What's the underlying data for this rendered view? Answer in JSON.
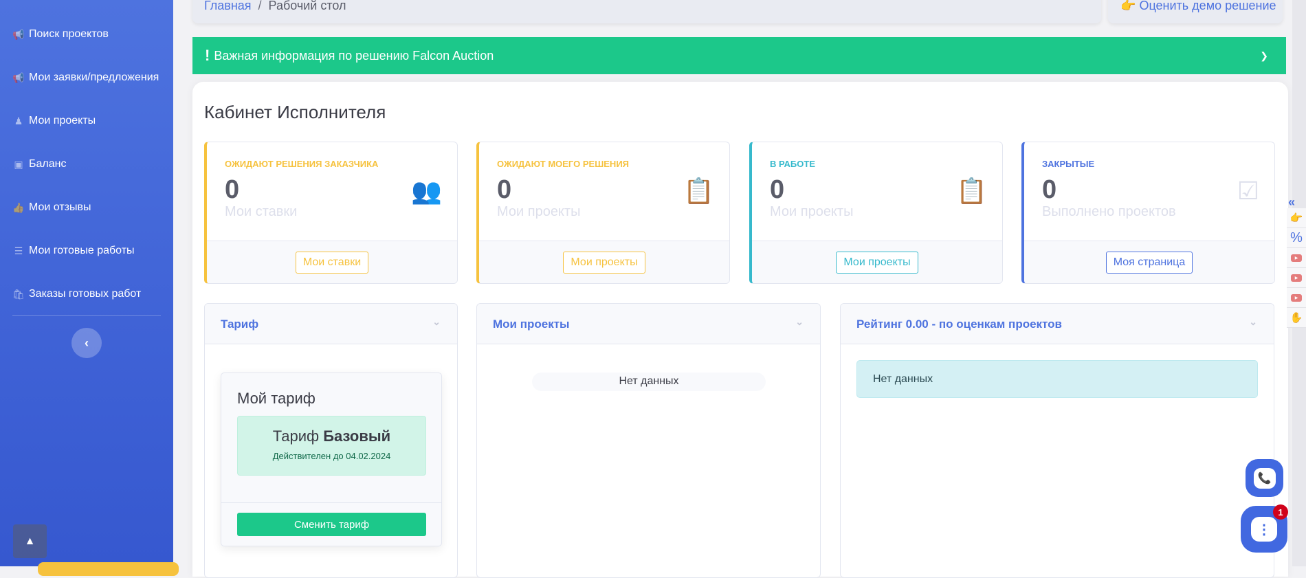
{
  "sidebar": {
    "items": [
      {
        "label": "Поиск проектов",
        "icon": "megaphone-icon"
      },
      {
        "label": "Мои заявки/предложения",
        "icon": "megaphone-icon"
      },
      {
        "label": "Мои проекты",
        "icon": "users-icon"
      },
      {
        "label": "Баланс",
        "icon": "money-icon"
      },
      {
        "label": "Мои отзывы",
        "icon": "thumbs-up-icon"
      },
      {
        "label": "Мои готовые работы",
        "icon": "list-icon"
      },
      {
        "label": "Заказы готовых работ",
        "icon": "bag-icon"
      }
    ]
  },
  "breadcrumb": {
    "home": "Главная",
    "separator": "/",
    "current": "Рабочий стол"
  },
  "rate_button": "Оценить демо решение",
  "alert": {
    "bang": "!",
    "text": "Важная информация по решению Falcon Auction"
  },
  "page_title": "Кабинет Исполнителя",
  "stats": [
    {
      "label": "Ожидают решения заказчика",
      "value": "0",
      "sub": "Мои ставки",
      "button": "Мои ставки",
      "color": "#f6c23e"
    },
    {
      "label": "Ожидают моего решения",
      "value": "0",
      "sub": "Мои проекты",
      "button": "Мои проекты",
      "color": "#f6c23e"
    },
    {
      "label": "В работе",
      "value": "0",
      "sub": "Мои проекты",
      "button": "Мои проекты",
      "color": "#36b9cc"
    },
    {
      "label": "Закрытые",
      "value": "0",
      "sub": "Выполнено проектов",
      "button": "Моя страница",
      "color": "#4e73df"
    }
  ],
  "panels": {
    "tariff": {
      "title": "Тариф",
      "card_title": "Мой тариф",
      "plan_prefix": "Тариф",
      "plan_name": "Базовый",
      "valid": "Действителен до 04.02.2024",
      "change": "Сменить тариф"
    },
    "projects": {
      "title": "Мои проекты",
      "empty": "Нет данных"
    },
    "rating": {
      "title": "Рейтинг 0.00 - по оценкам проектов",
      "empty": "Нет данных"
    }
  },
  "chat_badge": "1",
  "colors": {
    "primary": "#4e73df",
    "success": "#1cc88a",
    "warning": "#f6c23e",
    "info": "#36b9cc"
  }
}
